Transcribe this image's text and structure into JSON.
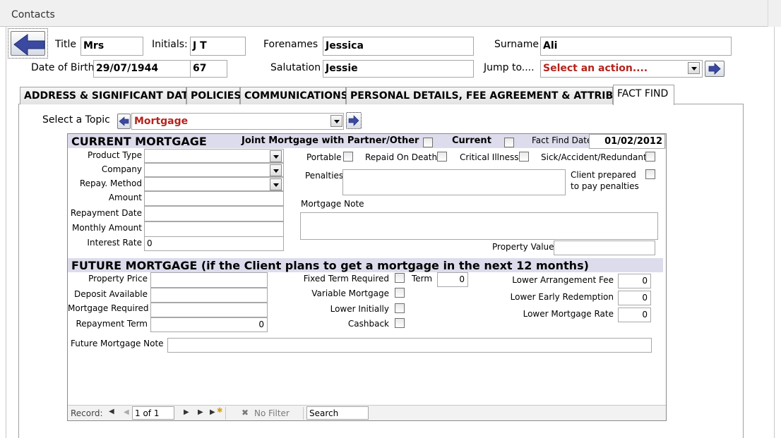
{
  "window": {
    "title": "Contacts"
  },
  "header": {
    "title_label": "Title",
    "title_value": "Mrs",
    "initials_label": "Initials:",
    "initials_value": "J T",
    "forenames_label": "Forenames",
    "forenames_value": "Jessica",
    "surname_label": "Surname",
    "surname_value": "Ali",
    "dob_label": "Date of Birth",
    "dob_value": "29/07/1944",
    "age_value": "67",
    "salutation_label": "Salutation",
    "salutation_value": "Jessie",
    "jump_label": "Jump to....",
    "jump_value": "Select an action...."
  },
  "tabs": [
    {
      "label": "ADDRESS & SIGNIFICANT DATES"
    },
    {
      "label": "POLICIES"
    },
    {
      "label": "COMMUNICATIONS"
    },
    {
      "label": "PERSONAL DETAILS, FEE AGREEMENT & ATTRIBUTES"
    },
    {
      "label": "FACT FIND",
      "active": true
    }
  ],
  "topic": {
    "label": "Select a Topic",
    "value": "Mortgage"
  },
  "current": {
    "heading": "CURRENT MORTGAGE",
    "joint_label": "Joint Mortgage with Partner/Other",
    "current_label": "Current",
    "fact_find_date_label": "Fact Find Date",
    "fact_find_date_value": "01/02/2012",
    "product_type_label": "Product Type",
    "company_label": "Company",
    "repay_method_label": "Repay. Method",
    "amount_label": "Amount",
    "repayment_date_label": "Repayment Date",
    "monthly_amount_label": "Monthly Amount",
    "interest_rate_label": "Interest Rate",
    "interest_rate_value": "0",
    "portable_label": "Portable",
    "repaid_on_death_label": "Repaid On Death",
    "critical_illness_label": "Critical Illness",
    "sick_label": "Sick/Accident/Redundant",
    "penalties_label": "Penalties",
    "client_prepared_label_1": "Client prepared",
    "client_prepared_label_2": "to pay penalties",
    "mortgage_note_label": "Mortgage Note",
    "property_value_label": "Property Value"
  },
  "future": {
    "heading": "FUTURE MORTGAGE (if the Client plans to get a mortgage in the next 12 months)",
    "property_price_label": "Property Price",
    "deposit_available_label": "Deposit Available",
    "mortgage_required_label": "Mortgage Required",
    "repayment_term_label": "Repayment Term",
    "repayment_term_value": "0",
    "fixed_term_label": "Fixed Term Required",
    "term_label": "Term",
    "term_value": "0",
    "variable_label": "Variable Mortgage",
    "lower_initially_label": "Lower Initially",
    "cashback_label": "Cashback",
    "lower_arrangement_label": "Lower Arrangement Fee",
    "lower_arrangement_value": "0",
    "lower_early_label": "Lower Early Redemption",
    "lower_early_value": "0",
    "lower_rate_label": "Lower Mortgage Rate",
    "lower_rate_value": "0",
    "future_note_label": "Future Mortgage Note"
  },
  "navigation": {
    "record_label": "Record:",
    "position_value": "1 of 1",
    "filter_label": "No Filter",
    "search_label": "Search"
  },
  "colors": {
    "section_header_bg": "#dcdcec",
    "red_text": "#b5231d",
    "arrow_blue": "#3b4aa0"
  }
}
